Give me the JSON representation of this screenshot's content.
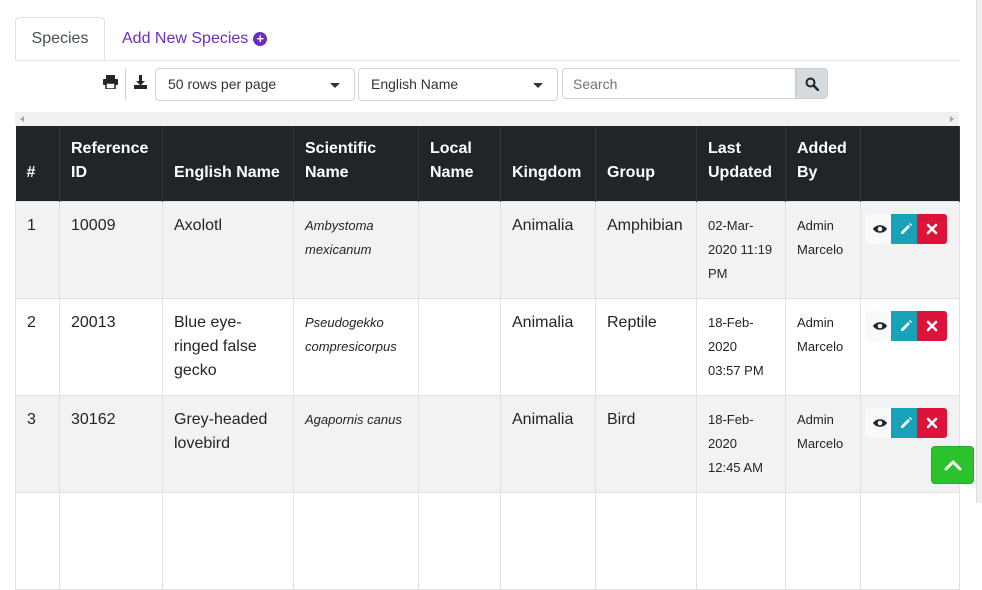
{
  "tabs": [
    {
      "label": "Species",
      "active": true
    },
    {
      "label": "Add New Species",
      "icon": "plus-circle-icon",
      "color": "#6f2dbd"
    }
  ],
  "toolbar": {
    "print_icon": "print-icon",
    "download_icon": "download-icon",
    "rows_per_page": {
      "selected": "50 rows per page"
    },
    "name_column": {
      "selected": "English Name"
    },
    "search": {
      "value": "",
      "placeholder": "Search"
    },
    "search_icon": "search-icon"
  },
  "table": {
    "headers": [
      "#",
      "Reference ID",
      "English Name",
      "Scientific Name",
      "Local Name",
      "Kingdom",
      "Group",
      "Last Updated",
      "Added By",
      ""
    ],
    "rows": [
      {
        "num": "1",
        "ref": "10009",
        "english": "Axolotl",
        "scientific": "Ambystoma mexicanum",
        "local": "",
        "kingdom": "Animalia",
        "group": "Amphibian",
        "updated": "02-Mar-2020 11:19 PM",
        "added_by": "Admin Marcelo"
      },
      {
        "num": "2",
        "ref": "20013",
        "english": "Blue eye-ringed false gecko",
        "scientific": "Pseudogekko compresicorpus",
        "local": "",
        "kingdom": "Animalia",
        "group": "Reptile",
        "updated": "18-Feb-2020 03:57 PM",
        "added_by": "Admin Marcelo"
      },
      {
        "num": "3",
        "ref": "30162",
        "english": "Grey-headed lovebird",
        "scientific": "Agapornis canus",
        "local": "",
        "kingdom": "Animalia",
        "group": "Bird",
        "updated": "18-Feb-2020 12:45 AM",
        "added_by": "Admin Marcelo"
      }
    ],
    "row_actions": [
      "eye-icon",
      "pencil-icon",
      "x-icon"
    ]
  },
  "colors": {
    "header_bg": "#212529",
    "edit_btn": "#17a2b8",
    "delete_btn": "#dc143c",
    "back_to_top": "#2bc32b",
    "accent": "#6f2dbd"
  },
  "back_to_top_icon": "chevron-up-icon"
}
